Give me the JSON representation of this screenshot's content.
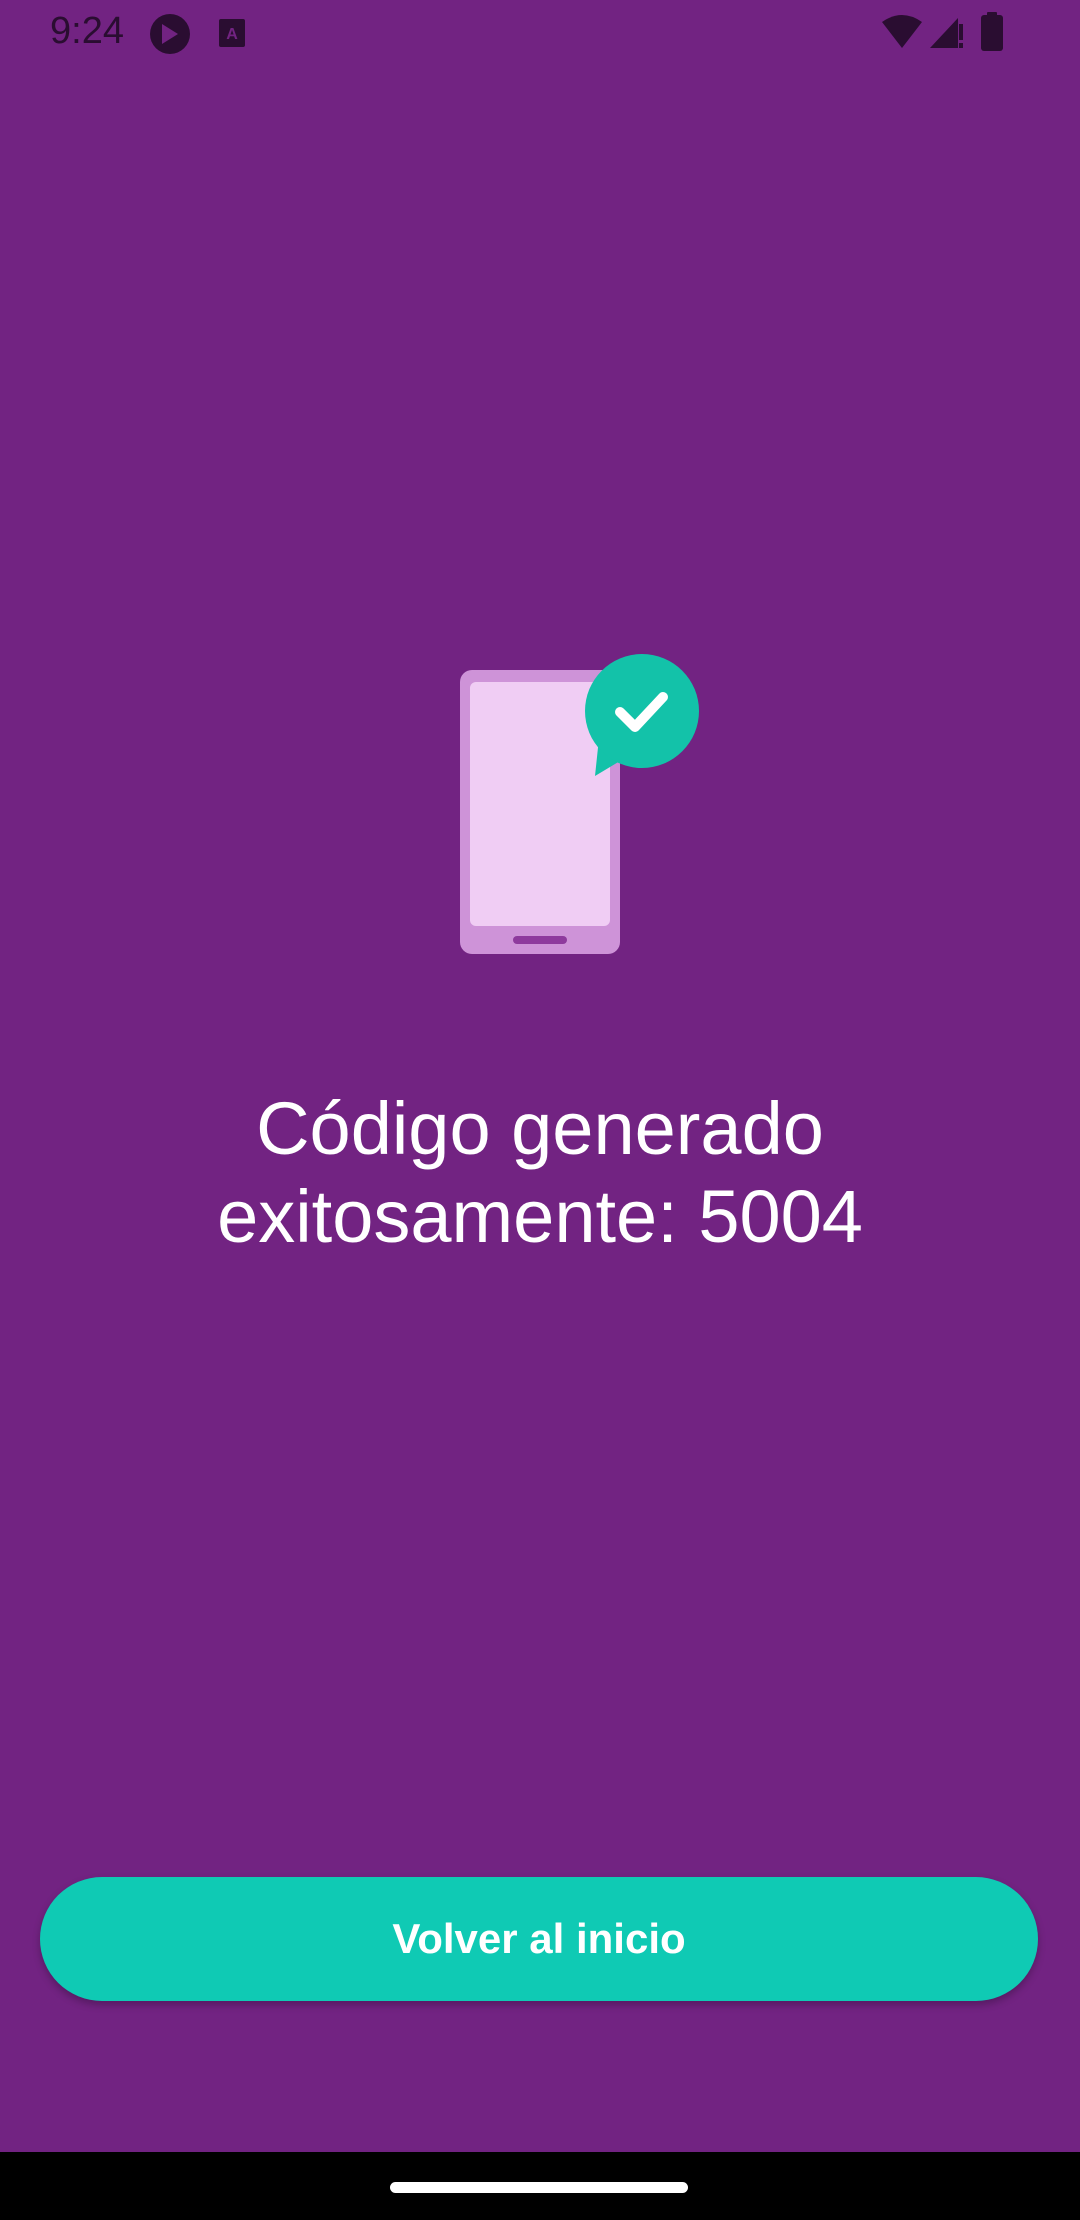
{
  "status_bar": {
    "time": "9:24",
    "icons": [
      "app-notification-icon",
      "keyboard-a-icon",
      "wifi-icon",
      "signal-icon",
      "battery-icon"
    ]
  },
  "illustration": {
    "icon": "phone-check-icon"
  },
  "main": {
    "message_line1": "Código generado",
    "message_line2": "exitosamente: 5004"
  },
  "actions": {
    "primary_label": "Volver al inicio"
  },
  "colors": {
    "background": "#722382",
    "accent": "#0fcab4",
    "phone_body": "#ce93d8",
    "phone_screen": "#f0cdf4"
  }
}
